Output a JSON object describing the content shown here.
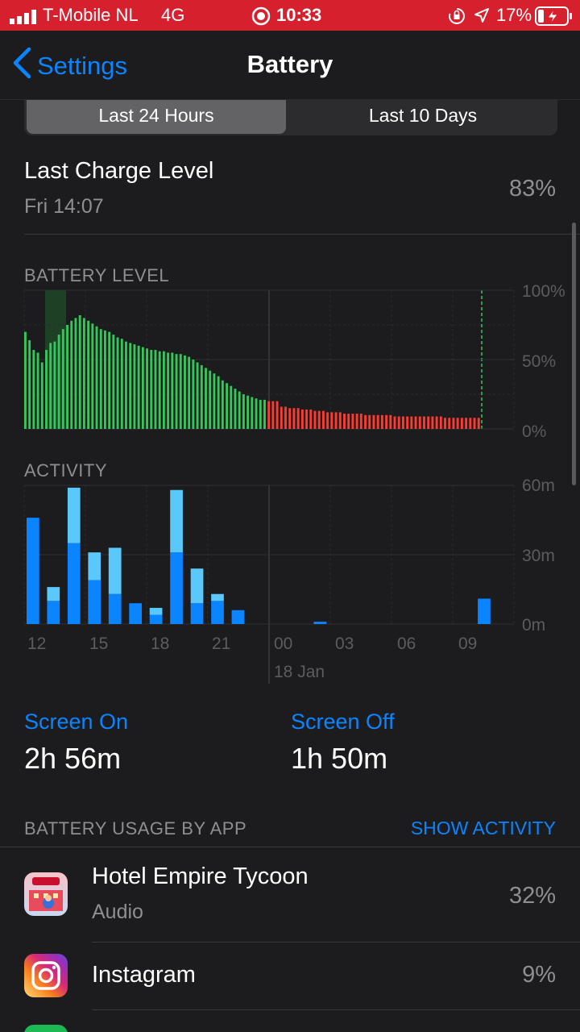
{
  "status": {
    "carrier": "T-Mobile NL",
    "network": "4G",
    "time": "10:33",
    "battery_percent": "17%"
  },
  "nav": {
    "back_label": "Settings",
    "title": "Battery"
  },
  "segmented": {
    "options": [
      "Last 24 Hours",
      "Last 10 Days"
    ],
    "selected": "Last 24 Hours"
  },
  "last_charge": {
    "label": "Last Charge Level",
    "time": "Fri 14:07",
    "value": "83%"
  },
  "battery_level": {
    "caption": "BATTERY LEVEL",
    "y_ticks": [
      "100%",
      "50%",
      "0%"
    ]
  },
  "activity": {
    "caption": "ACTIVITY",
    "y_ticks": [
      "60m",
      "30m",
      "0m"
    ],
    "x_ticks": [
      "12",
      "15",
      "18",
      "21",
      "00",
      "03",
      "06",
      "09"
    ],
    "date_label": "18 Jan"
  },
  "chart_data": [
    {
      "type": "bar",
      "title": "BATTERY LEVEL",
      "x_ticks": [
        "12",
        "15",
        "18",
        "21",
        "00",
        "03",
        "06",
        "09"
      ],
      "ylim": [
        0,
        100
      ],
      "y_ticks": [
        "100%",
        "50%",
        "0%"
      ],
      "charging_color": "#34c759",
      "low_color": "#ff3b30",
      "values": [
        70,
        64,
        57,
        55,
        48,
        57,
        62,
        63,
        68,
        72,
        75,
        78,
        80,
        82,
        80,
        78,
        76,
        74,
        72,
        71,
        70,
        68,
        66,
        65,
        63,
        62,
        61,
        60,
        59,
        58,
        57,
        57,
        56,
        56,
        55,
        55,
        54,
        54,
        53,
        52,
        50,
        48,
        46,
        44,
        42,
        40,
        38,
        35,
        33,
        31,
        29,
        27,
        25,
        24,
        23,
        22,
        21,
        21,
        20,
        20,
        20,
        16,
        16,
        15,
        15,
        15,
        14,
        14,
        14,
        13,
        13,
        13,
        12,
        12,
        12,
        12,
        11,
        11,
        11,
        11,
        11,
        10,
        10,
        10,
        10,
        10,
        10,
        10,
        9,
        9,
        9,
        9,
        9,
        9,
        9,
        9,
        9,
        9,
        9,
        9,
        8,
        8,
        8,
        8,
        8,
        8,
        8,
        8,
        8
      ]
    },
    {
      "type": "bar",
      "title": "ACTIVITY",
      "x_ticks": [
        "12",
        "15",
        "18",
        "21",
        "00",
        "03",
        "06",
        "09"
      ],
      "ylim": [
        0,
        60
      ],
      "y_ticks": [
        "60m",
        "30m",
        "0m"
      ],
      "series": [
        {
          "name": "Screen On",
          "color": "#0a84ff",
          "values": [
            46,
            10,
            35,
            19,
            13,
            9,
            4,
            31,
            9,
            10,
            6,
            0,
            0,
            0,
            1,
            0,
            0,
            0,
            0,
            0,
            0,
            0,
            11
          ]
        },
        {
          "name": "Screen Off",
          "color": "#5ac8fa",
          "values": [
            0,
            6,
            24,
            12,
            20,
            0,
            3,
            27,
            15,
            3,
            0,
            0,
            0,
            0,
            0,
            0,
            0,
            0,
            0,
            0,
            0,
            0,
            0
          ]
        }
      ]
    }
  ],
  "screen": {
    "on_label": "Screen On",
    "on_value": "2h 56m",
    "off_label": "Screen Off",
    "off_value": "1h 50m"
  },
  "usage": {
    "caption": "BATTERY USAGE BY APP",
    "show_activity": "SHOW ACTIVITY",
    "apps": [
      {
        "name": "Hotel Empire Tycoon",
        "subtitle": "Audio",
        "percent": "32%"
      },
      {
        "name": "Instagram",
        "subtitle": "",
        "percent": "9%"
      }
    ]
  }
}
